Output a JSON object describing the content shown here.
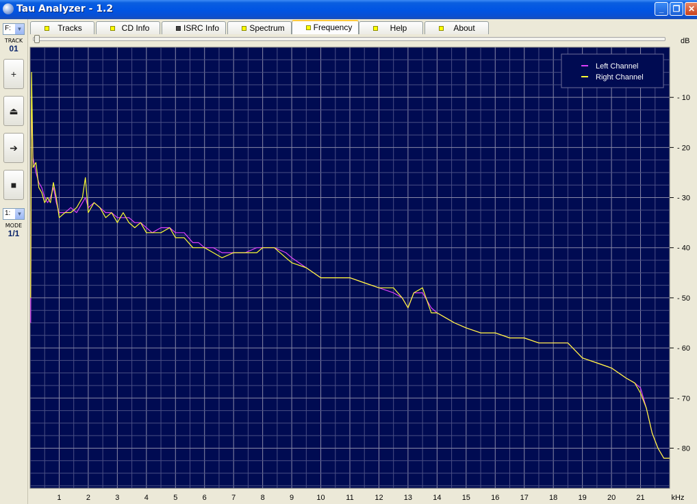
{
  "window": {
    "title": "Tau Analyzer - 1.2",
    "controls": [
      "_",
      "❐",
      "✕"
    ]
  },
  "toolbar": {
    "drive_value": "F:",
    "track_label": "TRACK",
    "track_value": "01",
    "buttons": [
      "+",
      "⏏",
      "➔",
      "■"
    ],
    "mode_combo_value": "1:",
    "mode_label": "MODE",
    "mode_value": "1/1"
  },
  "tabs": [
    {
      "label": "Tracks",
      "led": "yellow",
      "active": false
    },
    {
      "label": "CD Info",
      "led": "yellow",
      "active": false
    },
    {
      "label": "ISRC Info",
      "led": "grey",
      "active": false
    },
    {
      "label": "Spectrum",
      "led": "yellow",
      "active": false
    },
    {
      "label": "Frequency",
      "led": "yellow",
      "active": true
    },
    {
      "label": "Help",
      "led": "yellow",
      "active": false
    },
    {
      "label": "About",
      "led": "yellow",
      "active": false
    }
  ],
  "chart_data": {
    "type": "line",
    "xunit": "kHz",
    "yunit": "dB",
    "xlim": [
      0,
      22
    ],
    "ylim": [
      0,
      88
    ],
    "y_inverted": true,
    "x_ticks": [
      1,
      2,
      3,
      4,
      5,
      6,
      7,
      8,
      9,
      10,
      11,
      12,
      13,
      14,
      15,
      16,
      17,
      18,
      19,
      20,
      21
    ],
    "y_ticks": [
      10,
      20,
      30,
      40,
      50,
      60,
      70,
      80
    ],
    "grid": true,
    "background": "#000b52",
    "legend_placement": "top-right",
    "series": [
      {
        "name": "Left Channel",
        "color": "#e040fb",
        "x": [
          0.02,
          0.05,
          0.1,
          0.2,
          0.3,
          0.4,
          0.5,
          0.6,
          0.7,
          0.8,
          0.9,
          1.0,
          1.2,
          1.4,
          1.6,
          1.8,
          1.9,
          2.0,
          2.2,
          2.4,
          2.6,
          2.8,
          3.0,
          3.2,
          3.4,
          3.6,
          3.8,
          4.0,
          4.2,
          4.5,
          4.8,
          5.0,
          5.3,
          5.6,
          5.8,
          6.0,
          6.3,
          6.6,
          7.0,
          7.4,
          7.8,
          8.0,
          8.4,
          8.8,
          9.0,
          9.5,
          10.0,
          10.5,
          11.0,
          11.5,
          12.0,
          12.5,
          12.8,
          13.0,
          13.2,
          13.5,
          13.8,
          14.0,
          14.3,
          14.6,
          15.0,
          15.5,
          16.0,
          16.5,
          17.0,
          17.5,
          18.0,
          18.5,
          19.0,
          19.5,
          20.0,
          20.5,
          20.8,
          21.0,
          21.2,
          21.4,
          21.6,
          21.8,
          22.0
        ],
        "y": [
          55,
          10,
          22,
          25,
          27,
          28,
          30,
          31,
          30,
          28,
          31,
          33,
          33,
          32,
          33,
          31,
          30,
          32,
          31,
          32,
          33,
          33,
          34,
          34,
          34,
          35,
          35,
          36,
          37,
          36,
          36,
          37,
          37,
          39,
          39,
          40,
          40,
          41,
          41,
          41,
          40,
          40,
          40,
          41,
          42,
          44,
          46,
          46,
          46,
          47,
          48,
          49,
          50,
          52,
          49,
          49,
          52,
          53,
          54,
          55,
          56,
          57,
          57,
          58,
          58,
          59,
          59,
          59,
          62,
          63,
          64,
          66,
          67,
          68,
          72,
          77,
          80,
          82,
          82
        ]
      },
      {
        "name": "Right Channel",
        "color": "#ffff33",
        "x": [
          0.02,
          0.05,
          0.1,
          0.2,
          0.3,
          0.4,
          0.5,
          0.6,
          0.7,
          0.8,
          0.9,
          1.0,
          1.2,
          1.4,
          1.6,
          1.8,
          1.9,
          2.0,
          2.2,
          2.4,
          2.6,
          2.8,
          3.0,
          3.2,
          3.4,
          3.6,
          3.8,
          4.0,
          4.2,
          4.5,
          4.8,
          5.0,
          5.3,
          5.6,
          5.8,
          6.0,
          6.3,
          6.6,
          7.0,
          7.4,
          7.8,
          8.0,
          8.4,
          8.8,
          9.0,
          9.5,
          10.0,
          10.5,
          11.0,
          11.5,
          12.0,
          12.5,
          12.8,
          13.0,
          13.2,
          13.5,
          13.8,
          14.0,
          14.3,
          14.6,
          15.0,
          15.5,
          16.0,
          16.5,
          17.0,
          17.5,
          18.0,
          18.5,
          19.0,
          19.5,
          20.0,
          20.5,
          20.8,
          21.0,
          21.2,
          21.4,
          21.6,
          21.8,
          22.0
        ],
        "y": [
          50,
          5,
          24,
          23,
          28,
          29,
          31,
          30,
          31,
          27,
          30,
          34,
          33,
          33,
          32,
          30,
          26,
          33,
          31,
          32,
          34,
          33,
          35,
          33,
          35,
          36,
          35,
          37,
          37,
          37,
          36,
          38,
          38,
          40,
          40,
          40,
          41,
          42,
          41,
          41,
          41,
          40,
          40,
          42,
          43,
          44,
          46,
          46,
          46,
          47,
          48,
          48,
          50,
          52,
          49,
          48,
          53,
          53,
          54,
          55,
          56,
          57,
          57,
          58,
          58,
          59,
          59,
          59,
          62,
          63,
          64,
          66,
          67,
          69,
          72,
          77,
          80,
          82,
          82
        ]
      }
    ]
  }
}
